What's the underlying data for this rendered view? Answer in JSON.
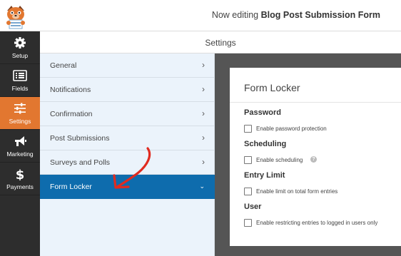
{
  "header": {
    "prefix": "Now editing",
    "form_name": "Blog Post Submission Form"
  },
  "sidebar": {
    "items": [
      {
        "label": "Setup",
        "icon": "gear-icon"
      },
      {
        "label": "Fields",
        "icon": "fields-list-icon"
      },
      {
        "label": "Settings",
        "icon": "sliders-icon",
        "active": true
      },
      {
        "label": "Marketing",
        "icon": "megaphone-icon"
      },
      {
        "label": "Payments",
        "icon": "dollar-icon"
      }
    ]
  },
  "subheader": {
    "title": "Settings"
  },
  "panels": {
    "items": [
      {
        "label": "General",
        "chevron": "›"
      },
      {
        "label": "Notifications",
        "chevron": "›"
      },
      {
        "label": "Confirmation",
        "chevron": "›"
      },
      {
        "label": "Post Submissions",
        "chevron": "›"
      },
      {
        "label": "Surveys and Polls",
        "chevron": "›"
      },
      {
        "label": "Form Locker",
        "chevron": "⌄",
        "active": true
      }
    ]
  },
  "form_locker": {
    "title": "Form Locker",
    "sections": [
      {
        "heading": "Password",
        "option": "Enable password protection"
      },
      {
        "heading": "Scheduling",
        "option": "Enable scheduling",
        "help": "?"
      },
      {
        "heading": "Entry Limit",
        "option": "Enable limit on total form entries"
      },
      {
        "heading": "User",
        "option": "Enable restricting entries to logged in users only"
      }
    ]
  },
  "colors": {
    "sidebar_bg": "#2d2d2d",
    "sidebar_active": "#e27730",
    "panel_active": "#0e6cad",
    "panel_bg": "#ebf3fb",
    "content_bg": "#555555",
    "arrow": "#e02b20"
  }
}
